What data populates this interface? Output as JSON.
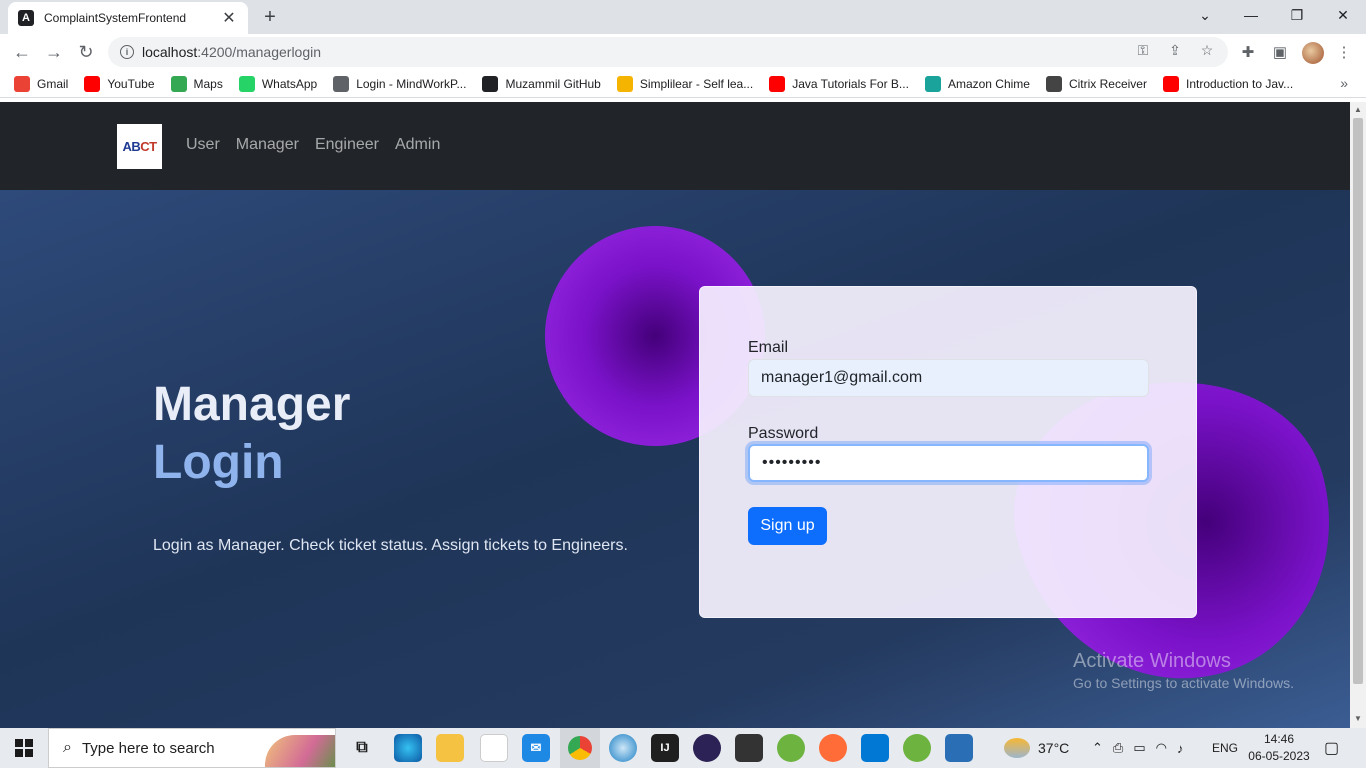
{
  "browser": {
    "tab_title": "ComplaintSystemFrontend",
    "url_host": "localhost",
    "url_path": ":4200/managerlogin"
  },
  "bookmarks": [
    {
      "label": "Gmail",
      "icon": "gmail-icon",
      "color": "#ea4335"
    },
    {
      "label": "YouTube",
      "icon": "youtube-icon",
      "color": "#ff0000"
    },
    {
      "label": "Maps",
      "icon": "maps-icon",
      "color": "#34a853"
    },
    {
      "label": "WhatsApp",
      "icon": "whatsapp-icon",
      "color": "#25d366"
    },
    {
      "label": "Login - MindWorkP...",
      "icon": "globe-icon",
      "color": "#5f6368"
    },
    {
      "label": "Muzammil GitHub",
      "icon": "github-icon",
      "color": "#202124"
    },
    {
      "label": "Simplilear - Self lea...",
      "icon": "simplilearn-icon",
      "color": "#f4b400"
    },
    {
      "label": "Java Tutorials For B...",
      "icon": "youtube-icon",
      "color": "#ff0000"
    },
    {
      "label": "Amazon Chime",
      "icon": "chime-icon",
      "color": "#1aa39b"
    },
    {
      "label": "Citrix Receiver",
      "icon": "citrix-icon",
      "color": "#444"
    },
    {
      "label": "Introduction to Jav...",
      "icon": "youtube-icon",
      "color": "#ff0000"
    }
  ],
  "navbar": {
    "logo_text_a": "AB",
    "logo_text_b": "CT",
    "links": [
      "User",
      "Manager",
      "Engineer",
      "Admin"
    ]
  },
  "hero": {
    "title_line1": "Manager",
    "title_line2": "Login",
    "description": "Login as Manager. Check ticket status. Assign tickets to Engineers."
  },
  "form": {
    "email_label": "Email",
    "email_value": "manager1@gmail.com",
    "password_label": "Password",
    "password_value": "•••••••••",
    "submit_label": "Sign up"
  },
  "watermark": {
    "line1": "Activate Windows",
    "line2": "Go to Settings to activate Windows."
  },
  "taskbar": {
    "search_placeholder": "Type here to search",
    "weather": "37°C",
    "language": "ENG",
    "time": "14:46",
    "date": "06-05-2023"
  }
}
